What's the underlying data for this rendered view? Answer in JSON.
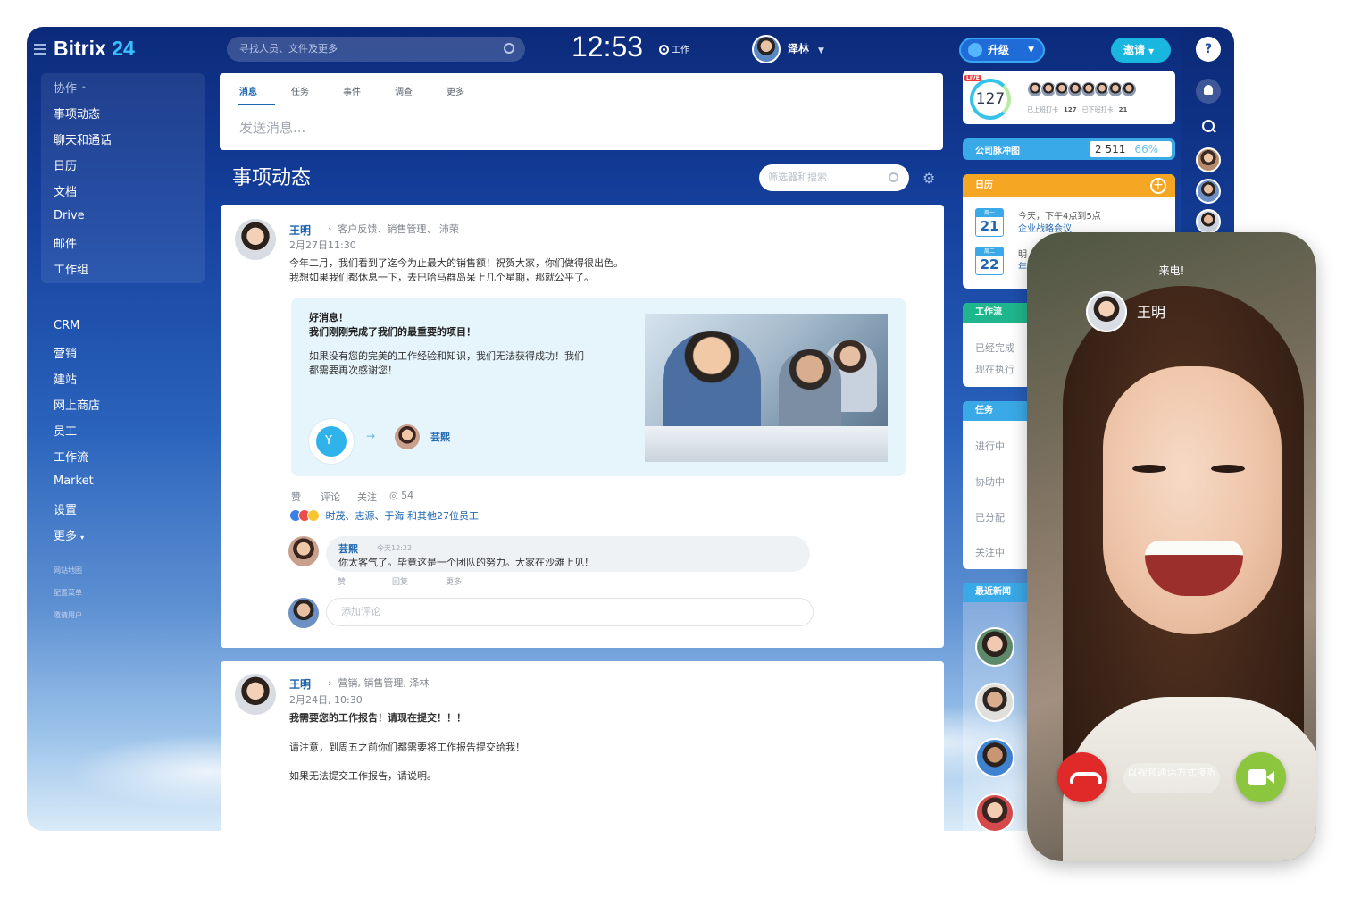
{
  "app": {
    "logo_word": "Bitrix",
    "logo_number": "24",
    "search_placeholder": "寻找人员、文件及更多",
    "clock": "12:53",
    "work_status": "工作",
    "current_user": "泽林",
    "upgrade_label": "升级",
    "invite_label": "邀请"
  },
  "sidebar": {
    "group_label": "协作",
    "group_items": [
      "事项动态",
      "聊天和通话",
      "日历",
      "文档",
      "Drive",
      "邮件",
      "工作组"
    ],
    "items": [
      "CRM",
      "营销",
      "建站",
      "网上商店",
      "员工",
      "工作流",
      "Market",
      "设置",
      "更多"
    ],
    "footer_links": [
      "网站地图",
      "配置菜单",
      "邀请用户"
    ]
  },
  "composer": {
    "tabs": [
      "消息",
      "任务",
      "事件",
      "调查",
      "更多"
    ],
    "placeholder": "发送消息..."
  },
  "feed": {
    "title": "事项动态",
    "filter_placeholder": "筛选器和搜索"
  },
  "posts": [
    {
      "author": "王明",
      "destinations": "客户反馈、销售管理、 沛荣",
      "date": "2月27日11:30",
      "text_lines": [
        "今年二月，我们看到了迄今为止最大的销售额！祝贺大家，你们做得很出色。",
        "我想如果我们都休息一下，去巴哈马群岛呆上几个星期，那就公平了。"
      ],
      "card": {
        "headline1": "好消息！",
        "headline2": "我们刚刚完成了我们的最重要的项目！",
        "body_lines": [
          "如果没有您的完美的工作经验和知识，我们无法获得成功！我们",
          "都需要再次感谢您！"
        ],
        "recipient": "芸熙"
      },
      "actions": [
        "赞",
        "评论",
        "关注"
      ],
      "views": "54",
      "likes": "时茂、志源、于海 和其他27位员工",
      "comment": {
        "author": "芸熙",
        "time": "今天12:22",
        "text": "你太客气了。毕竟这是一个团队的努力。大家在沙滩上见！",
        "actions": [
          "赞",
          "回复",
          "更多"
        ]
      },
      "add_comment_placeholder": "添加评论"
    },
    {
      "author": "王明",
      "destinations": "营销, 销售管理, 泽林",
      "date": "2月24日, 10:30",
      "headline": "我需要您的工作报告！请现在提交！！！",
      "text_lines": [
        "请注意，到周五之前你们都需要将工作报告提交给我！",
        "如果无法提交工作报告，请说明。"
      ]
    }
  ],
  "right_widgets": {
    "live": {
      "tag": "LIVE",
      "count": "127",
      "checked_in_label": "已上班打卡",
      "checked_in": "127",
      "checked_out_label": "已下班打卡",
      "checked_out": "21"
    },
    "pulse": {
      "label": "公司脉冲图",
      "value": "2 511",
      "percent": "66%"
    },
    "calendar": {
      "title": "日历",
      "events": [
        {
          "dow": "周一",
          "day": "21",
          "line1": "今天，下午4点到5点",
          "line2": "企业战略会议"
        },
        {
          "dow": "周二",
          "day": "22",
          "line1": "明",
          "line2": "年"
        }
      ]
    },
    "workflows": {
      "title": "工作流",
      "items": [
        "已经完成",
        "现在执行"
      ]
    },
    "tasks": {
      "title": "任务",
      "items": [
        "进行中",
        "协助中",
        "已分配",
        "关注中"
      ]
    },
    "news": {
      "title": "最近新闻"
    }
  },
  "call": {
    "status": "来电!",
    "caller": "王明",
    "video_answer_label": "以视频通话方式接听"
  },
  "colors": {
    "accent_blue": "#2067b0",
    "calendar_orange": "#f5a623",
    "workflow_green": "#20b68d",
    "decline_red": "#e02a2a",
    "accept_green": "#8cc63f"
  }
}
